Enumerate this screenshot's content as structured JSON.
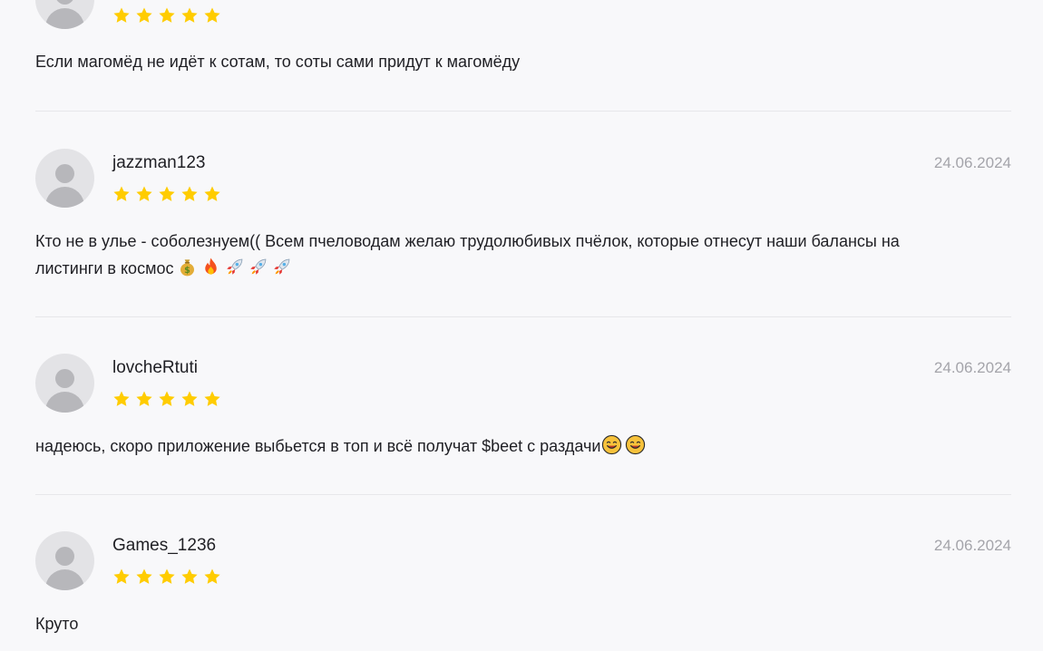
{
  "reviews": [
    {
      "username": "",
      "date": "",
      "rating": 5,
      "text": "Если магомёд не идёт к сотам, то соты сами придут к магомёду"
    },
    {
      "username": "jazzman123",
      "date": "24.06.2024",
      "rating": 5,
      "text_line1": "Кто не в улье - соболезнуем(( Всем пчеловодам желаю трудолюбивых пчёлок, которые отнесут наши балансы на",
      "text_line2": "листинги в космос",
      "emojis": [
        "money-bag-icon",
        "fire-icon",
        "rocket-icon",
        "rocket-icon",
        "rocket-icon"
      ]
    },
    {
      "username": "lovcheRtuti",
      "date": "24.06.2024",
      "rating": 5,
      "text": "надеюсь, скоро приложение выбьется в топ и всё получат $beet с раздачи",
      "emojis": [
        "smiling-face-icon",
        "smiling-face-icon"
      ]
    },
    {
      "username": "Games_1236",
      "date": "24.06.2024",
      "rating": 5,
      "text": "Круто"
    }
  ],
  "colors": {
    "background": "#f8f8fa",
    "star": "#ffcc00",
    "divider": "#e7e7ea",
    "date": "#a4a4aa",
    "avatar_bg": "#e3e3e6",
    "avatar_fg": "#b7b7bb"
  }
}
